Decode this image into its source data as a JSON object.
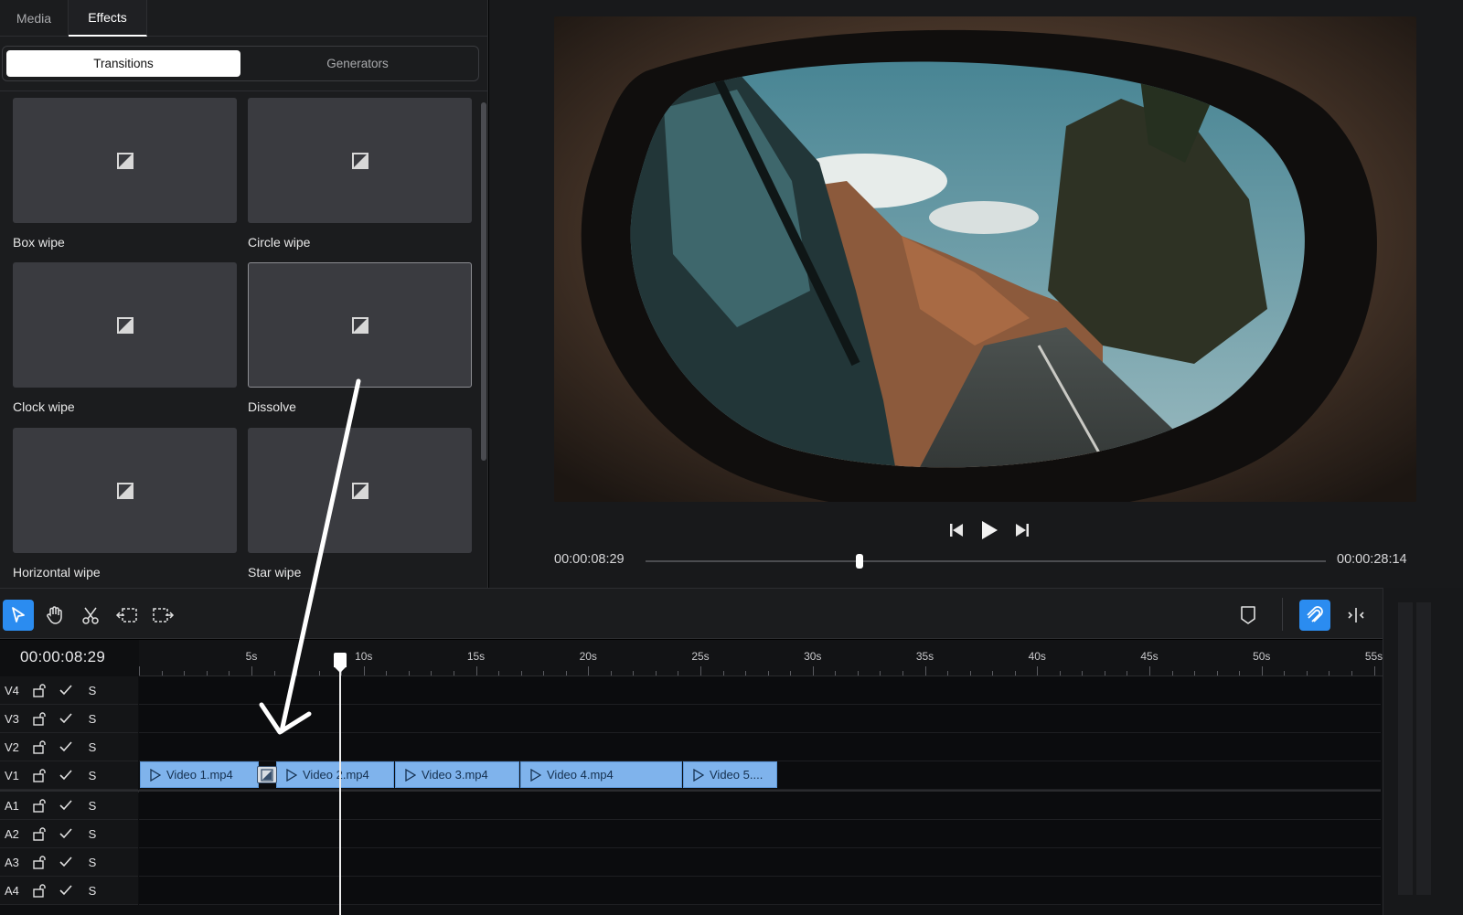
{
  "panel_tabs": {
    "media": "Media",
    "effects": "Effects"
  },
  "segments": {
    "transitions": "Transitions",
    "generators": "Generators"
  },
  "transitions": [
    {
      "label": "Box wipe"
    },
    {
      "label": "Circle wipe"
    },
    {
      "label": "Clock wipe"
    },
    {
      "label": "Dissolve"
    },
    {
      "label": "Horizontal wipe"
    },
    {
      "label": "Star wipe"
    }
  ],
  "preview": {
    "current_time": "00:00:08:29",
    "total_time": "00:00:28:14",
    "progress": 0.315
  },
  "timeline": {
    "timecode": "00:00:08:29",
    "ruler_labels": [
      "5s",
      "10s",
      "15s",
      "20s",
      "25s",
      "30s",
      "35s",
      "40s",
      "45s",
      "50s",
      "55s"
    ],
    "video_tracks": [
      "V4",
      "V3",
      "V2",
      "V1"
    ],
    "audio_tracks": [
      "A1",
      "A2",
      "A3",
      "A4"
    ],
    "solo_label": "S",
    "clips": [
      {
        "name": "Video 1.mp4"
      },
      {
        "name": "Video 2.mp4"
      },
      {
        "name": "Video 3.mp4"
      },
      {
        "name": "Video 4.mp4"
      },
      {
        "name": "Video 5...."
      }
    ]
  },
  "colors": {
    "accent": "#2b8cf0",
    "clip": "#7fb3ec",
    "background": "#0e0f11"
  },
  "icons": [
    "select-icon",
    "hand-icon",
    "scissors-icon",
    "trim-left-icon",
    "trim-right-icon",
    "marker-icon",
    "magnet-icon",
    "split-icon",
    "lock-icon",
    "check-icon",
    "skip-back-icon",
    "play-icon",
    "skip-forward-icon",
    "transition-icon"
  ]
}
